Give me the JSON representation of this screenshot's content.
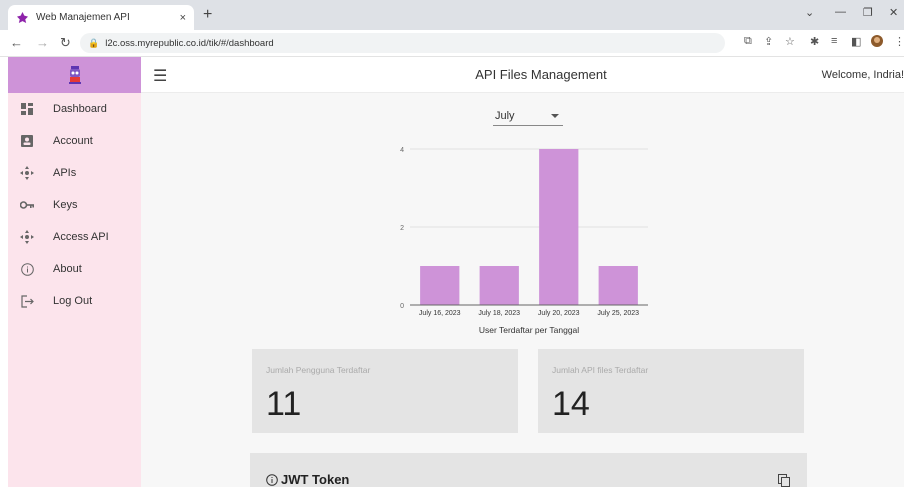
{
  "browser": {
    "tab_title": "Web Manajemen API",
    "tab_close": "×",
    "new_tab": "+",
    "url": "l2c.oss.myrepublic.co.id/tik/#/dashboard"
  },
  "header": {
    "title": "API Files Management",
    "welcome": "Welcome, Indria!"
  },
  "sidebar": {
    "items": [
      {
        "label": "Dashboard",
        "icon": "dashboard-icon"
      },
      {
        "label": "Account",
        "icon": "account-icon"
      },
      {
        "label": "APIs",
        "icon": "apis-icon"
      },
      {
        "label": "Keys",
        "icon": "key-icon"
      },
      {
        "label": "Access API",
        "icon": "access-api-icon"
      },
      {
        "label": "About",
        "icon": "info-icon"
      },
      {
        "label": "Log Out",
        "icon": "logout-icon"
      }
    ]
  },
  "filter": {
    "month": "July"
  },
  "chart_data": {
    "type": "bar",
    "categories": [
      "July 16, 2023",
      "July 18, 2023",
      "July 20, 2023",
      "July 25, 2023"
    ],
    "values": [
      1,
      1,
      4,
      1
    ],
    "xlabel": "User Terdaftar per Tanggal",
    "ylabel": "",
    "ylim": [
      0,
      4
    ],
    "yticks": [
      0,
      2,
      4
    ],
    "grid": true,
    "color": "#ce93d8"
  },
  "stats": {
    "users_label": "Jumlah Pengguna Terdaftar",
    "users_value": "11",
    "files_label": "Jumlah API files Terdaftar",
    "files_value": "14"
  },
  "jwt": {
    "title": "JWT Token"
  },
  "colors": {
    "accent": "#ce93d8",
    "sidebar_bg": "#fce4ec",
    "card_bg": "#e4e4e4"
  }
}
